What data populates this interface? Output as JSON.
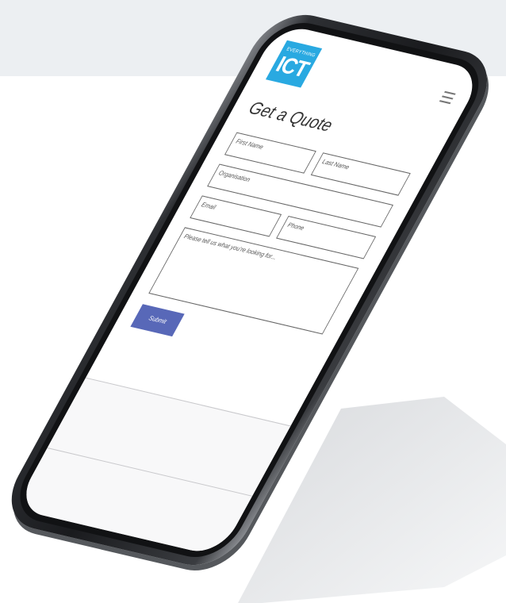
{
  "brand": {
    "logo_small": "EVERYTHING",
    "logo_big": "ICT",
    "color": "#29a9e1"
  },
  "header": {
    "menu_icon": "hamburger-menu-icon"
  },
  "form": {
    "title": "Get a Quote",
    "first_name_placeholder": "First Name",
    "last_name_placeholder": "Last Name",
    "organisation_placeholder": "Organisation",
    "email_placeholder": "Email",
    "phone_placeholder": "Phone",
    "message_placeholder": "Please tell us what you're looking for...",
    "submit_label": "Submit",
    "submit_color": "#5868b8"
  }
}
